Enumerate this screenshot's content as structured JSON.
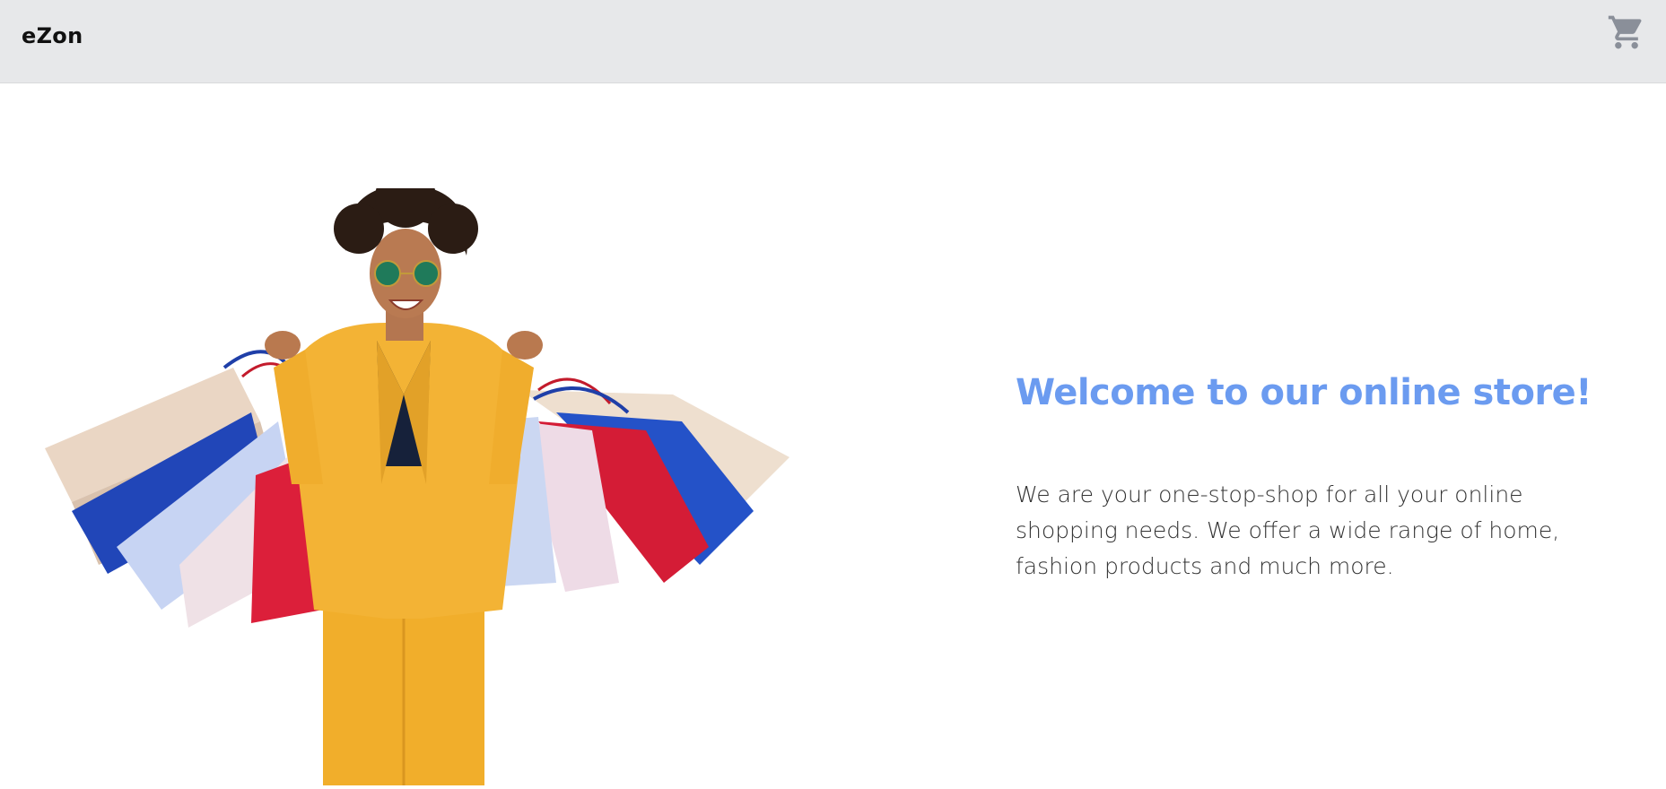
{
  "header": {
    "brand": "eZon",
    "cart_icon": "shopping-cart-icon"
  },
  "hero": {
    "image": "woman-with-shopping-bags-illustration",
    "title": "Welcome to our online store!",
    "description": "We are your one-stop-shop for all your online shopping needs. We offer a wide range of home, fashion products and much more."
  },
  "colors": {
    "header_bg": "#e7e8ea",
    "title": "#6b9bf0",
    "cart_icon": "#8a8f99",
    "text": "#333333"
  }
}
